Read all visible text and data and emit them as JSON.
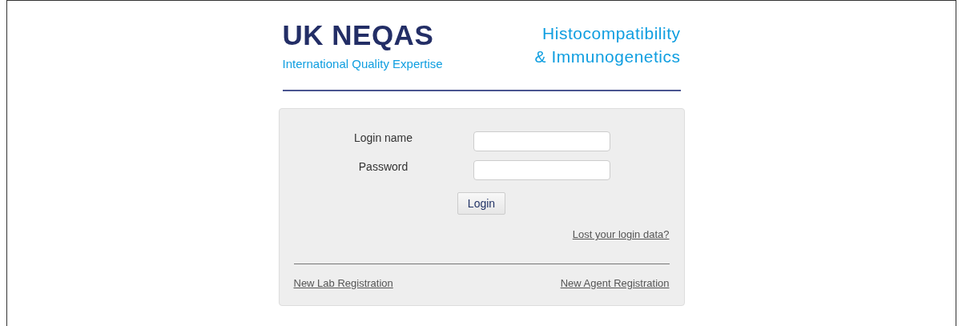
{
  "logo": {
    "title": "UK NEQAS",
    "tagline": "International Quality Expertise",
    "department_lines": [
      "Histocompatibility",
      "& Immunogenetics"
    ]
  },
  "form": {
    "fields": [
      {
        "label": "Login name"
      },
      {
        "label": "Password"
      }
    ],
    "submit": "Login",
    "forgot_link": "Lost your login data?",
    "footer_links": [
      "New Lab Registration",
      "New Agent Registration"
    ]
  }
}
